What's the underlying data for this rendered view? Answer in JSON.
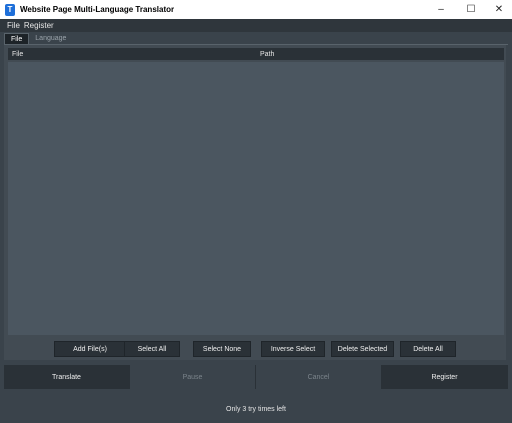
{
  "window": {
    "title": "Website Page Multi-Language Translator",
    "icon": "app-logo-icon",
    "controls": {
      "minimize": "–",
      "maximize": "☐",
      "close": "✕"
    }
  },
  "menubar": {
    "items": [
      "File",
      "Register"
    ]
  },
  "tabs": [
    {
      "label": "File",
      "active": true
    },
    {
      "label": "Language",
      "active": false
    }
  ],
  "table": {
    "columns": [
      "File",
      "Path"
    ],
    "rows": []
  },
  "file_buttons": {
    "add": "Add File(s)",
    "select_all": "Select All",
    "select_none": "Select None",
    "inverse_select": "Inverse Select",
    "delete_selected": "Delete Selected",
    "delete_all": "Delete All"
  },
  "actions": {
    "translate": "Translate",
    "pause": "Pause",
    "cancel": "Cancel",
    "register": "Register"
  },
  "status": "Only 3 try times left"
}
